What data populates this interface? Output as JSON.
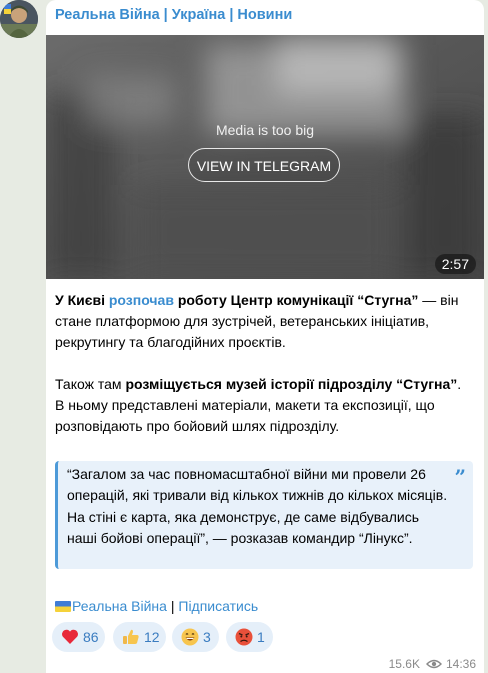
{
  "channel": {
    "title": "Реальна Війна | Україна | Новини"
  },
  "media": {
    "notice": "Media is too big",
    "button_label": "VIEW IN TELEGRAM",
    "duration": "2:57"
  },
  "post": {
    "p1": {
      "a": "У Києві ",
      "link": "розпочав",
      "b": " роботу Центр комунікації “Стугна”",
      "c": " — він стане платформою для зустрічей, ветеранських ініціатив, рекрутингу та благодійних проєктів."
    },
    "p2": {
      "a": "Також там ",
      "b": "розміщується музей історії підрозділу “Стугна”",
      "c": ". В ньому представлені матеріали, макети та експозиції, що розповідають про бойовий шлях підрозділу."
    },
    "quote": "“Загалом за час повномасштабної війни ми провели 26 операцій, які тривали від кількох тижнів до кількох місяців. На стіні є карта, яка демонструє, де саме відбувались наші бойові операції”, — розказав командир “Лінукс”.",
    "quote_mark": "”",
    "signature": {
      "channel_link": "Реальна Війна",
      "separator": " | ",
      "subscribe_link": "Підписатись"
    }
  },
  "reactions": [
    {
      "icon": "heart-emoji",
      "count": "86"
    },
    {
      "icon": "thumbs-up-emoji",
      "count": "12"
    },
    {
      "icon": "grinning-face-emoji",
      "count": "3"
    },
    {
      "icon": "angry-face-emoji",
      "count": "1"
    }
  ],
  "meta": {
    "views": "15.6K",
    "time": "14:36"
  },
  "colors": {
    "background": "#e7ebe3",
    "accent": "#3a8ccf",
    "quote_background": "#e8f1fa",
    "reaction_background": "#e5eff9"
  }
}
